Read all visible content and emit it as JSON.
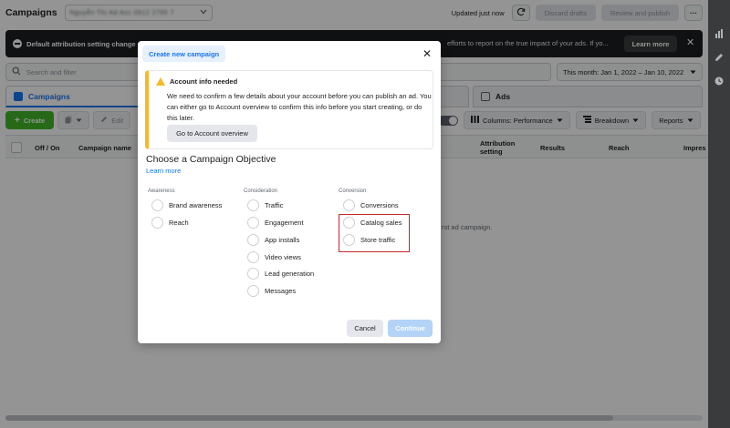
{
  "topbar": {
    "title": "Campaigns",
    "account_name": "Nguyễn Thị Ad Acc 0912 2765 7",
    "updated": "Updated just now",
    "discard": "Discard drafts",
    "review": "Review and publish",
    "more": "···"
  },
  "banner": {
    "title": "Default attribution setting change",
    "message": "efforts to report on the true impact of your ads. If yo...",
    "learn_more": "Learn more",
    "close": "✕"
  },
  "search": {
    "placeholder": "Search and filter",
    "date_range": "This month: Jan 1, 2022 – Jan 10, 2022"
  },
  "levels": {
    "campaigns": "Campaigns",
    "ads": "Ads"
  },
  "toolbar": {
    "create": "Create",
    "edit": "Edit",
    "columns": "Columns: Performance",
    "breakdown": "Breakdown",
    "reports": "Reports"
  },
  "table": {
    "headers": [
      "Off / On",
      "Campaign name",
      "Attribution setting",
      "Results",
      "Reach",
      "Impres"
    ],
    "empty_message": "rst ad campaign."
  },
  "modal": {
    "tab": "Create new campaign",
    "close": "✕",
    "notice": {
      "title": "Account info needed",
      "body": "We need to confirm a few details about your account before you can publish an ad. You can either go to Account overview to confirm this info before you start creating, or do this later.",
      "button": "Go to Account overview"
    },
    "objective_title": "Choose a Campaign Objective",
    "learn_more": "Learn more",
    "columns": {
      "awareness": {
        "label": "Awareness",
        "options": [
          "Brand awareness",
          "Reach"
        ]
      },
      "consideration": {
        "label": "Consideration",
        "options": [
          "Traffic",
          "Engagement",
          "App installs",
          "Video views",
          "Lead generation",
          "Messages"
        ]
      },
      "conversion": {
        "label": "Conversion",
        "options": [
          "Conversions",
          "Catalog sales",
          "Store traffic"
        ]
      }
    },
    "cancel": "Cancel",
    "continue": "Continue"
  },
  "colors": {
    "accent": "#1877f2",
    "create_green": "#42b72a",
    "warning": "#f7b928",
    "highlight_red": "#c62828"
  }
}
